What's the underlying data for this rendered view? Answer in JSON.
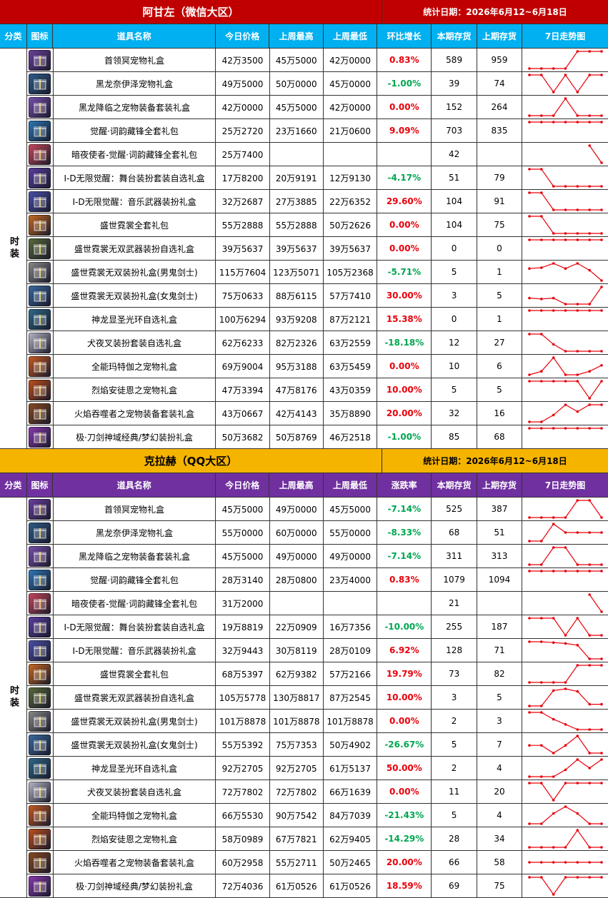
{
  "sections": [
    {
      "title": "阿甘左（微信大区）",
      "date": "统计日期：2026年6月12~6月18日",
      "category": "时装",
      "headers": [
        "分类",
        "图标",
        "道具名称",
        "今日价格",
        "上周最高",
        "上周最低",
        "环比增长",
        "本期存货",
        "上期存货",
        "7日走势图"
      ],
      "rows": [
        {
          "name": "首领冥宠物礼盒",
          "today": "42万3500",
          "high": "45万5000",
          "low": "42万0000",
          "pct": "0.83%",
          "dir": "up",
          "stock": "589",
          "prev": "959",
          "icon": "purple-gift-box-icon",
          "trend": [
            0,
            0,
            0,
            0,
            1,
            1,
            1
          ]
        },
        {
          "name": "黑龙奈伊泽宠物礼盒",
          "today": "49万5000",
          "high": "50万0000",
          "low": "45万0000",
          "pct": "-1.00%",
          "dir": "down",
          "stock": "39",
          "prev": "74",
          "icon": "black-dragon-gift-icon",
          "trend": [
            1,
            1,
            0,
            1,
            0,
            1,
            1
          ]
        },
        {
          "name": "黑龙降临之宠物装备套装礼盒",
          "today": "42万0000",
          "high": "45万5000",
          "low": "42万0000",
          "pct": "0.00%",
          "dir": "zero",
          "stock": "152",
          "prev": "264",
          "icon": "dragon-equipment-box-icon",
          "trend": [
            0,
            0,
            0,
            1,
            0,
            0,
            0
          ]
        },
        {
          "name": "觉醒·词韵藏锋全套礼包",
          "today": "25万2720",
          "high": "23万1660",
          "low": "21万0600",
          "pct": "9.09%",
          "dir": "up",
          "stock": "703",
          "prev": "835",
          "icon": "awakening-package-icon",
          "trend": [
            1,
            1,
            1,
            1,
            1,
            1,
            1
          ]
        },
        {
          "name": "暗夜使者-觉醒·词韵藏锋全套礼包",
          "today": "25万7400",
          "high": "",
          "low": "",
          "pct": "",
          "dir": "none",
          "stock": "42",
          "prev": "",
          "icon": "dark-envoy-package-icon",
          "trend": [
            null,
            null,
            null,
            null,
            null,
            1,
            0
          ]
        },
        {
          "name": "I-D无限觉醒：舞台装扮套装自选礼盒",
          "today": "17万8200",
          "high": "20万9191",
          "low": "12万9130",
          "pct": "-4.17%",
          "dir": "down",
          "stock": "51",
          "prev": "79",
          "icon": "stage-costume-box-icon",
          "trend": [
            1,
            1,
            0,
            0,
            0,
            0,
            0
          ]
        },
        {
          "name": "I-D无限觉醒：音乐武器装扮礼盒",
          "today": "32万2687",
          "high": "27万3885",
          "low": "22万6352",
          "pct": "29.60%",
          "dir": "up",
          "stock": "104",
          "prev": "91",
          "icon": "music-weapon-box-icon",
          "trend": [
            1,
            1,
            0,
            0,
            0,
            0,
            0
          ]
        },
        {
          "name": "盛世霓裳全套礼包",
          "today": "55万2888",
          "high": "55万2888",
          "low": "50万2626",
          "pct": "0.00%",
          "dir": "zero",
          "stock": "104",
          "prev": "75",
          "icon": "neon-costume-package-icon",
          "trend": [
            1,
            1,
            0,
            0,
            0,
            0,
            0
          ]
        },
        {
          "name": "盛世霓裳无双武器装扮自选礼盒",
          "today": "39万5637",
          "high": "39万5637",
          "low": "39万5637",
          "pct": "0.00%",
          "dir": "zero",
          "stock": "0",
          "prev": "0",
          "icon": "weapon-costume-box-icon",
          "trend": [
            1,
            1,
            1,
            1,
            1,
            1,
            1
          ]
        },
        {
          "name": "盛世霓裳无双装扮礼盒(男鬼剑士)",
          "today": "115万7604",
          "high": "123万5071",
          "low": "105万2368",
          "pct": "-5.71%",
          "dir": "down",
          "stock": "5",
          "prev": "1",
          "icon": "male-slayer-box-icon",
          "trend": [
            0.7,
            0.75,
            1,
            0.7,
            1,
            0.6,
            0
          ]
        },
        {
          "name": "盛世霓裳无双装扮礼盒(女鬼剑士)",
          "today": "75万0633",
          "high": "88万6115",
          "low": "57万7410",
          "pct": "30.00%",
          "dir": "up",
          "stock": "3",
          "prev": "5",
          "icon": "female-slayer-box-icon",
          "trend": [
            0.35,
            0.3,
            0.35,
            0,
            0,
            0,
            1
          ]
        },
        {
          "name": "神龙显圣光环自选礼盒",
          "today": "100万6294",
          "high": "93万9208",
          "low": "87万2121",
          "pct": "15.38%",
          "dir": "up",
          "stock": "0",
          "prev": "1",
          "icon": "dragon-aura-box-icon",
          "trend": [
            1,
            1,
            1,
            1,
            1,
            1,
            1
          ]
        },
        {
          "name": "犬夜叉装扮套装自选礼盒",
          "today": "62万6233",
          "high": "82万2326",
          "low": "63万2559",
          "pct": "-18.18%",
          "dir": "down",
          "stock": "12",
          "prev": "27",
          "icon": "inuyasha-box-icon",
          "trend": [
            1,
            1,
            0.4,
            0,
            0,
            0,
            0
          ]
        },
        {
          "name": "全能玛特伽之宠物礼盒",
          "today": "69万9004",
          "high": "95万3188",
          "low": "63万5459",
          "pct": "0.00%",
          "dir": "zero",
          "stock": "10",
          "prev": "6",
          "icon": "pet-gift-red-icon",
          "trend": [
            0,
            0.2,
            1,
            0,
            0,
            0.2,
            0.55
          ]
        },
        {
          "name": "烈焰安徒恩之宠物礼盒",
          "today": "47万3394",
          "high": "47万8176",
          "low": "43万0359",
          "pct": "10.00%",
          "dir": "up",
          "stock": "5",
          "prev": "5",
          "icon": "flame-pet-box-icon",
          "trend": [
            1,
            1,
            1,
            1,
            1,
            0,
            1
          ]
        },
        {
          "name": "火焰吞噬者之宠物装备套装礼盒",
          "today": "43万0667",
          "high": "42万4143",
          "low": "35万8890",
          "pct": "20.00%",
          "dir": "up",
          "stock": "32",
          "prev": "16",
          "icon": "fire-devourer-box-icon",
          "trend": [
            0,
            0,
            0.4,
            1,
            0.6,
            1,
            1
          ]
        },
        {
          "name": "极·刀剑神域经典/梦幻装扮礼盒",
          "today": "50万3682",
          "high": "50万8769",
          "low": "46万2518",
          "pct": "-1.00%",
          "dir": "down",
          "stock": "85",
          "prev": "68",
          "icon": "sword-art-box-icon",
          "trend": [
            1,
            1,
            1,
            1,
            1,
            1,
            1
          ]
        }
      ]
    },
    {
      "title": "克拉赫（QQ大区）",
      "date": "统计日期：2026年6月12~6月18日",
      "category": "时装",
      "headers": [
        "分类",
        "图标",
        "道具名称",
        "今日价格",
        "上周最高",
        "上周最低",
        "涨跌率",
        "本期存货",
        "上期存货",
        "7日走势图"
      ],
      "rows": [
        {
          "name": "首领冥宠物礼盒",
          "today": "45万5000",
          "high": "49万0000",
          "low": "45万5000",
          "pct": "-7.14%",
          "dir": "down",
          "stock": "525",
          "prev": "387",
          "icon": "purple-gift-box-icon",
          "trend": [
            0,
            0,
            0,
            0,
            1,
            1,
            0
          ]
        },
        {
          "name": "黑龙奈伊泽宠物礼盒",
          "today": "55万0000",
          "high": "60万0000",
          "low": "55万0000",
          "pct": "-8.33%",
          "dir": "down",
          "stock": "68",
          "prev": "51",
          "icon": "black-dragon-gift-icon",
          "trend": [
            0,
            0,
            1,
            0.5,
            0.5,
            0.5,
            0.5
          ]
        },
        {
          "name": "黑龙降临之宠物装备套装礼盒",
          "today": "45万5000",
          "high": "49万0000",
          "low": "49万0000",
          "pct": "-7.14%",
          "dir": "down",
          "stock": "311",
          "prev": "313",
          "icon": "dragon-equipment-box-icon",
          "trend": [
            0,
            0,
            1,
            1,
            0,
            0,
            0
          ]
        },
        {
          "name": "觉醒·词韵藏锋全套礼包",
          "today": "28万3140",
          "high": "28万0800",
          "low": "23万4000",
          "pct": "0.83%",
          "dir": "up",
          "stock": "1079",
          "prev": "1094",
          "icon": "awakening-package-icon",
          "trend": [
            1,
            1,
            1,
            1,
            1,
            1,
            1
          ]
        },
        {
          "name": "暗夜使者-觉醒·词韵藏锋全套礼包",
          "today": "31万2000",
          "high": "",
          "low": "",
          "pct": "",
          "dir": "none",
          "stock": "21",
          "prev": "",
          "icon": "dark-envoy-package-icon",
          "trend": [
            null,
            null,
            null,
            null,
            null,
            1,
            0
          ]
        },
        {
          "name": "I-D无限觉醒：舞台装扮套装自选礼盒",
          "today": "19万8819",
          "high": "22万0909",
          "low": "16万7356",
          "pct": "-10.00%",
          "dir": "down",
          "stock": "255",
          "prev": "187",
          "icon": "stage-costume-box-icon",
          "trend": [
            1,
            1,
            1,
            0,
            1,
            0,
            0
          ]
        },
        {
          "name": "I-D无限觉醒：音乐武器装扮礼盒",
          "today": "32万9443",
          "high": "30万8119",
          "low": "28万0109",
          "pct": "6.92%",
          "dir": "up",
          "stock": "128",
          "prev": "71",
          "icon": "music-weapon-box-icon",
          "trend": [
            1,
            1,
            0.95,
            0.9,
            0.8,
            0,
            0
          ]
        },
        {
          "name": "盛世霓裳全套礼包",
          "today": "68万5397",
          "high": "62万9382",
          "low": "57万2166",
          "pct": "19.79%",
          "dir": "up",
          "stock": "73",
          "prev": "82",
          "icon": "neon-costume-package-icon",
          "trend": [
            0,
            0,
            0,
            0,
            1,
            1,
            1
          ]
        },
        {
          "name": "盛世霓裳无双武器装扮自选礼盒",
          "today": "105万5778",
          "high": "130万8817",
          "low": "87万2545",
          "pct": "10.00%",
          "dir": "up",
          "stock": "3",
          "prev": "5",
          "icon": "weapon-costume-box-icon",
          "trend": [
            0,
            0,
            0.9,
            1,
            0.85,
            0.1,
            0.1
          ]
        },
        {
          "name": "盛世霓裳无双装扮礼盒(男鬼剑士)",
          "today": "101万8878",
          "high": "101万8878",
          "low": "101万8878",
          "pct": "0.00%",
          "dir": "zero",
          "stock": "2",
          "prev": "3",
          "icon": "male-slayer-box-icon",
          "trend": [
            1,
            1,
            0.6,
            0.3,
            0,
            0,
            0
          ]
        },
        {
          "name": "盛世霓裳无双装扮礼盒(女鬼剑士)",
          "today": "55万5392",
          "high": "75万7353",
          "low": "50万4902",
          "pct": "-26.67%",
          "dir": "down",
          "stock": "5",
          "prev": "7",
          "icon": "female-slayer-box-icon",
          "trend": [
            0.45,
            0.45,
            0,
            0.45,
            1,
            0,
            0
          ]
        },
        {
          "name": "神龙显圣光环自选礼盒",
          "today": "92万2705",
          "high": "92万2705",
          "low": "61万5137",
          "pct": "50.00%",
          "dir": "up",
          "stock": "2",
          "prev": "4",
          "icon": "dragon-aura-box-icon",
          "trend": [
            0,
            0,
            0,
            0.4,
            1,
            0.5,
            1
          ]
        },
        {
          "name": "犬夜叉装扮套装自选礼盒",
          "today": "72万7802",
          "high": "72万7802",
          "low": "66万1639",
          "pct": "0.00%",
          "dir": "zero",
          "stock": "11",
          "prev": "20",
          "icon": "inuyasha-box-icon",
          "trend": [
            1,
            1,
            0,
            1,
            1,
            1,
            1
          ]
        },
        {
          "name": "全能玛特伽之宠物礼盒",
          "today": "66万5530",
          "high": "90万7542",
          "low": "84万7039",
          "pct": "-21.43%",
          "dir": "down",
          "stock": "5",
          "prev": "4",
          "icon": "pet-gift-red-icon",
          "trend": [
            0,
            0,
            0.6,
            1,
            0.6,
            0,
            0
          ]
        },
        {
          "name": "烈焰安徒恩之宠物礼盒",
          "today": "58万0989",
          "high": "67万7821",
          "low": "62万9405",
          "pct": "-14.29%",
          "dir": "down",
          "stock": "28",
          "prev": "34",
          "icon": "flame-pet-box-icon",
          "trend": [
            0,
            0,
            0,
            0,
            1,
            0,
            0
          ]
        },
        {
          "name": "火焰吞噬者之宠物装备套装礼盒",
          "today": "60万2958",
          "high": "55万2711",
          "low": "50万2465",
          "pct": "20.00%",
          "dir": "up",
          "stock": "66",
          "prev": "58",
          "icon": "fire-devourer-box-icon",
          "trend": [
            0.5,
            0.5,
            0.5,
            0.5,
            0.5,
            0.5,
            0.5
          ]
        },
        {
          "name": "极·刀剑神域经典/梦幻装扮礼盒",
          "today": "72万4036",
          "high": "61万0526",
          "low": "61万0526",
          "pct": "18.59%",
          "dir": "up",
          "stock": "69",
          "prev": "75",
          "icon": "sword-art-box-icon",
          "trend": [
            1,
            1,
            0,
            1,
            1,
            1,
            1
          ]
        }
      ]
    }
  ],
  "colors": {
    "section_a_title_bg": "#c00000",
    "section_a_header_bg": "#00b0f0",
    "section_b_title_bg": "#f5b400",
    "section_b_header_bg": "#7030a0",
    "up": "#e8000b",
    "down": "#00a650",
    "trend_line": "#e8000b"
  },
  "icon_colors": {
    "purple-gift-box-icon": "#6b3fa0",
    "black-dragon-gift-icon": "#2e5c8a",
    "dragon-equipment-box-icon": "#7a4fb0",
    "awakening-package-icon": "#2d78b8",
    "dark-envoy-package-icon": "#c8485a",
    "stage-costume-box-icon": "#5a3fa0",
    "music-weapon-box-icon": "#4a4fa8",
    "neon-costume-package-icon": "#c96a20",
    "weapon-costume-box-icon": "#5a6a3a",
    "male-slayer-box-icon": "#8a8a8a",
    "female-slayer-box-icon": "#3a6aa0",
    "dragon-aura-box-icon": "#2e6a8a",
    "inuyasha-box-icon": "#b8b8c8",
    "pet-gift-red-icon": "#c85a20",
    "flame-pet-box-icon": "#c0501a",
    "fire-devourer-box-icon": "#8a4a20",
    "sword-art-box-icon": "#8a3ab0"
  }
}
